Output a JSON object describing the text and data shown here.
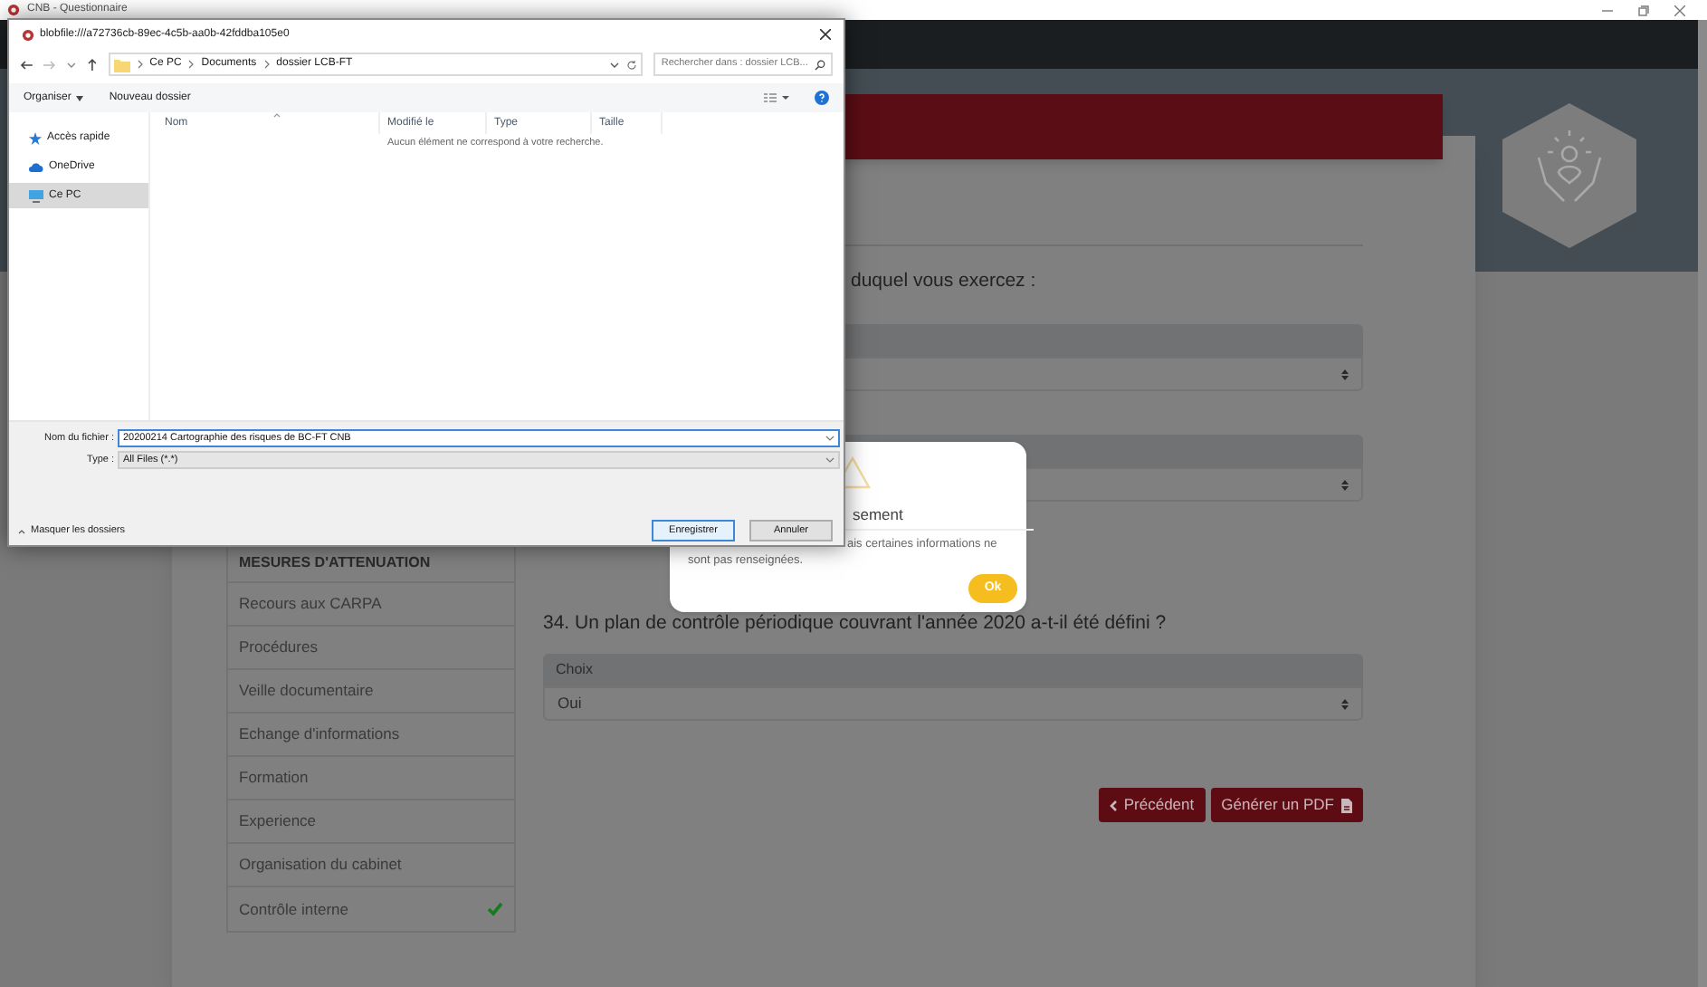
{
  "window": {
    "title": "CNB - Questionnaire"
  },
  "page": {
    "question_1_tail": "duquel vous exercez :",
    "sidebar": {
      "header": "MESURES D'ATTENUATION",
      "items": [
        {
          "label": "Recours aux CARPA",
          "done": false
        },
        {
          "label": "Procédures",
          "done": false
        },
        {
          "label": "Veille documentaire",
          "done": false
        },
        {
          "label": "Echange d'informations",
          "done": false
        },
        {
          "label": "Formation",
          "done": false
        },
        {
          "label": "Experience",
          "done": false
        },
        {
          "label": "Organisation du cabinet",
          "done": false
        },
        {
          "label": "Contrôle interne",
          "done": true
        }
      ]
    },
    "question": "34. Un plan de contrôle périodique couvrant l'année 2020 a-t-il été défini ?",
    "choice": {
      "header": "Choix",
      "value": "Oui"
    },
    "buttons": [
      {
        "label": "Précédent"
      },
      {
        "label": "Générer un PDF"
      }
    ]
  },
  "alert": {
    "title_tail": "sement",
    "message_tail": "ais certaines informations ne",
    "message_line_2": "sont pas renseignées.",
    "button": "Ok"
  },
  "save_dialog": {
    "title": "blobfile:///a72736cb-89ec-4c5b-aa0b-42fddba105e0",
    "breadcrumb": [
      "Ce PC",
      "Documents",
      "dossier LCB-FT"
    ],
    "search_placeholder": "Rechercher dans : dossier LCB...",
    "toolbar": [
      "Organiser",
      "Nouveau dossier"
    ],
    "nav": [
      {
        "label": "Accès rapide",
        "selected": false
      },
      {
        "label": "OneDrive",
        "selected": false
      },
      {
        "label": "Ce PC",
        "selected": true
      }
    ],
    "columns": [
      "Nom",
      "Modifié le",
      "Type",
      "Taille"
    ],
    "empty_message": "Aucun élément ne correspond à votre recherche.",
    "filename_label": "Nom du fichier :",
    "filename": "20200214 Cartographie des risques de BC-FT CNB",
    "type_label": "Type :",
    "type": "All Files (*.*)",
    "hide_folders": "Masquer les dossiers",
    "buttons": [
      "Enregistrer",
      "Annuler"
    ]
  }
}
